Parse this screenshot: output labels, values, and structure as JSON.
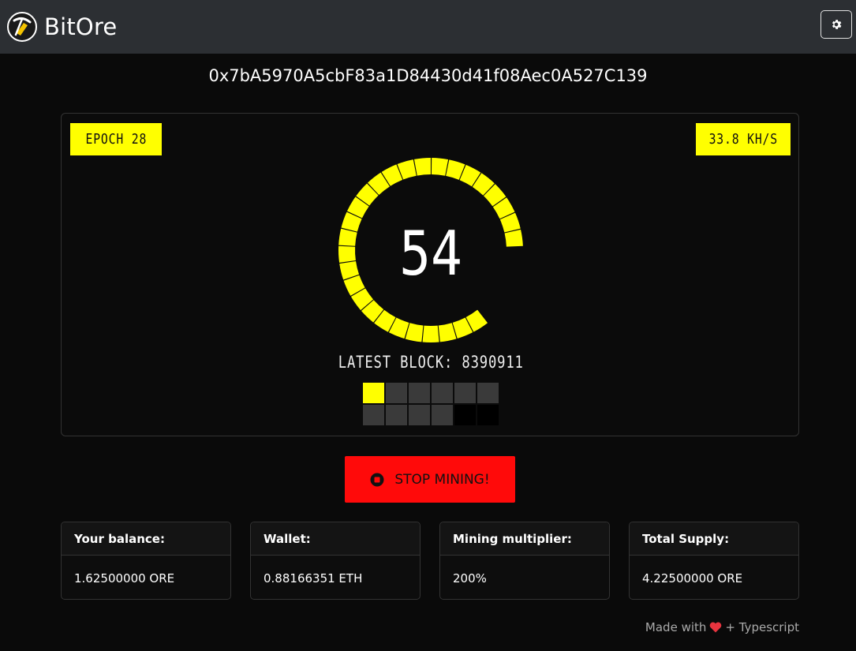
{
  "app": {
    "name": "BitOre"
  },
  "navbar": {
    "settings_icon": "gear-icon"
  },
  "wallet_address": "0x7bA5970A5cbF83a1D84430d41f08Aec0A527C139",
  "miner": {
    "epoch_label": "EPOCH 28",
    "hash_rate": "33.8 KH/S",
    "counter": "54",
    "latest_block_label": "LATEST BLOCK: 8390911",
    "gauge_progress_percent": 85,
    "accent_color": "#ffff00",
    "progress_cells": [
      "active",
      "filled",
      "filled",
      "filled",
      "filled",
      "filled",
      "filled",
      "filled",
      "filled",
      "filled",
      "empty",
      "empty"
    ]
  },
  "stop_button": {
    "label": "STOP MINING!",
    "icon": "stop-icon",
    "color": "#ff0a0a"
  },
  "stats": [
    {
      "title": "Your balance:",
      "value": "1.62500000 ORE"
    },
    {
      "title": "Wallet:",
      "value": "0.88166351 ETH"
    },
    {
      "title": "Mining multiplier:",
      "value": "200%"
    },
    {
      "title": "Total Supply:",
      "value": "4.22500000 ORE"
    }
  ],
  "footer": {
    "prefix": "Made with",
    "suffix": "+ Typescript",
    "icon": "heart-icon"
  }
}
